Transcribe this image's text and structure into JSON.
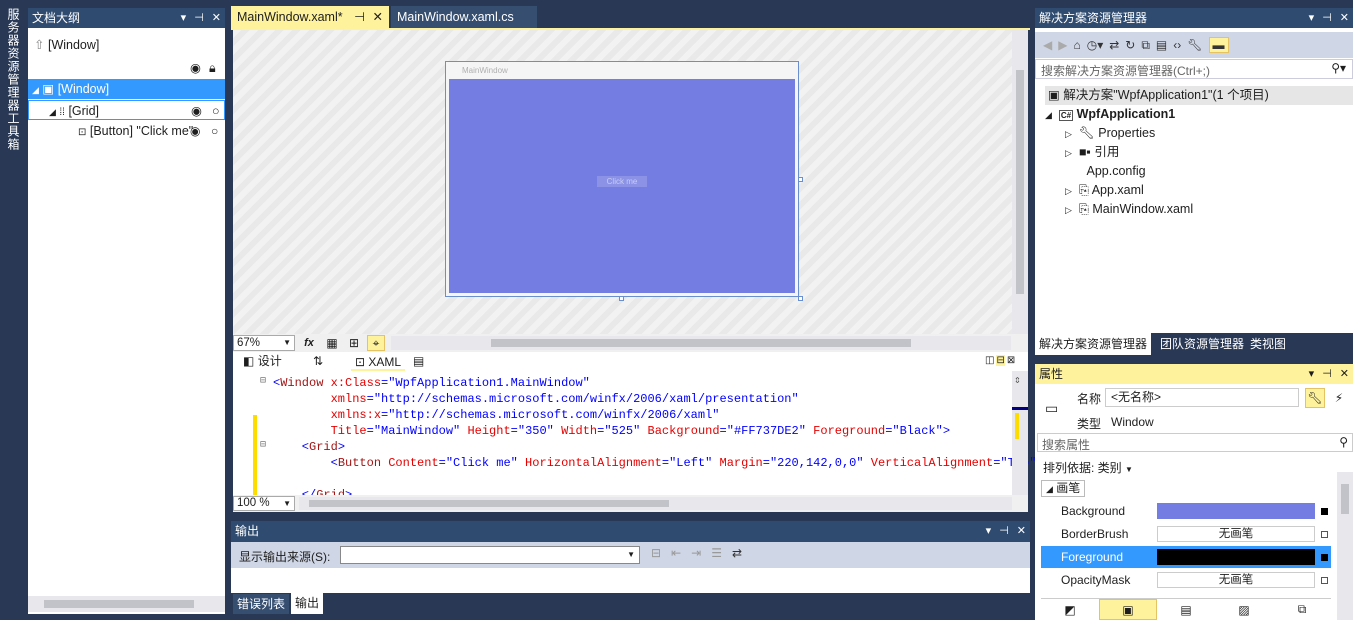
{
  "side_tabs": [
    "服务器资源管理器",
    "工具箱"
  ],
  "outline": {
    "title": "文档大纲",
    "root": "[Window]",
    "items": [
      {
        "label": "[Window]",
        "selected": true
      },
      {
        "label": "[Grid]"
      },
      {
        "label": "[Button] \"Click me\""
      }
    ]
  },
  "designer": {
    "tabs": [
      "MainWindow.xaml*",
      "MainWindow.xaml.cs"
    ],
    "window_title": "MainWindow",
    "button_text": "Click me",
    "background": "#737DE2",
    "zoom": "67%",
    "fx_label": "fx",
    "view_tabs": {
      "design": "设计",
      "swap": "⇅",
      "xaml": "XAML"
    },
    "code_lines": [
      [
        {
          "c": "pu",
          "t": "<"
        },
        {
          "c": "tg",
          "t": "Window"
        },
        {
          "c": "at",
          "t": " x:Class"
        },
        {
          "c": "pu",
          "t": "="
        },
        {
          "c": "va",
          "t": "\"WpfApplication1.MainWindow\""
        }
      ],
      [
        {
          "c": "at",
          "t": "        xmlns"
        },
        {
          "c": "pu",
          "t": "="
        },
        {
          "c": "va",
          "t": "\"http://schemas.microsoft.com/winfx/2006/xaml/presentation\""
        }
      ],
      [
        {
          "c": "at",
          "t": "        xmlns:x"
        },
        {
          "c": "pu",
          "t": "="
        },
        {
          "c": "va",
          "t": "\"http://schemas.microsoft.com/winfx/2006/xaml\""
        }
      ],
      [
        {
          "c": "at",
          "t": "        Title"
        },
        {
          "c": "pu",
          "t": "="
        },
        {
          "c": "va",
          "t": "\"MainWindow\""
        },
        {
          "c": "at",
          "t": " Height"
        },
        {
          "c": "pu",
          "t": "="
        },
        {
          "c": "va",
          "t": "\"350\""
        },
        {
          "c": "at",
          "t": " Width"
        },
        {
          "c": "pu",
          "t": "="
        },
        {
          "c": "va",
          "t": "\"525\""
        },
        {
          "c": "at",
          "t": " Background"
        },
        {
          "c": "pu",
          "t": "="
        },
        {
          "c": "va",
          "t": "\"#FF737DE2\""
        },
        {
          "c": "at",
          "t": " Foreground"
        },
        {
          "c": "pu",
          "t": "="
        },
        {
          "c": "va",
          "t": "\"Black\""
        },
        {
          "c": "pu",
          "t": ">"
        }
      ],
      [
        {
          "c": "pu",
          "t": "    <"
        },
        {
          "c": "tg",
          "t": "Grid"
        },
        {
          "c": "pu",
          "t": ">"
        }
      ],
      [
        {
          "c": "pu",
          "t": "        <"
        },
        {
          "c": "tg",
          "t": "Button"
        },
        {
          "c": "at",
          "t": " Content"
        },
        {
          "c": "pu",
          "t": "="
        },
        {
          "c": "va",
          "t": "\"Click me\""
        },
        {
          "c": "at",
          "t": " HorizontalAlignment"
        },
        {
          "c": "pu",
          "t": "="
        },
        {
          "c": "va",
          "t": "\"Left\""
        },
        {
          "c": "at",
          "t": " Margin"
        },
        {
          "c": "pu",
          "t": "="
        },
        {
          "c": "va",
          "t": "\"220,142,0,0\""
        },
        {
          "c": "at",
          "t": " VerticalAlignment"
        },
        {
          "c": "pu",
          "t": "="
        },
        {
          "c": "va",
          "t": "\"Top\""
        }
      ],
      [],
      [
        {
          "c": "pu",
          "t": "    </"
        },
        {
          "c": "tg",
          "t": "Grid"
        },
        {
          "c": "pu",
          "t": ">"
        }
      ]
    ],
    "code_zoom": "100 %"
  },
  "output": {
    "title": "输出",
    "source_label": "显示输出来源(S):",
    "tabs": [
      "错误列表",
      "输出"
    ]
  },
  "solution": {
    "title": "解决方案资源管理器",
    "search_placeholder": "搜索解决方案资源管理器(Ctrl+;)",
    "root": "解决方案\"WpfApplication1\"(1 个项目)",
    "project": "WpfApplication1",
    "items": [
      "Properties",
      "引用",
      "App.config",
      "App.xaml",
      "MainWindow.xaml"
    ],
    "project_badge": "C#",
    "bottom_tabs": [
      "解决方案资源管理器",
      "团队资源管理器",
      "类视图"
    ]
  },
  "properties": {
    "title": "属性",
    "name_label": "名称",
    "name_value": "<无名称>",
    "type_label": "类型",
    "type_value": "Window",
    "search_placeholder": "搜索属性",
    "sort_label": "排列依据: 类别",
    "category": "画笔",
    "rows": [
      {
        "name": "Background",
        "value": "",
        "color": "#737DE2"
      },
      {
        "name": "BorderBrush",
        "value": "无画笔",
        "color": ""
      },
      {
        "name": "Foreground",
        "value": "",
        "color": "#000000",
        "selected": true
      },
      {
        "name": "OpacityMask",
        "value": "无画笔",
        "color": ""
      }
    ]
  }
}
